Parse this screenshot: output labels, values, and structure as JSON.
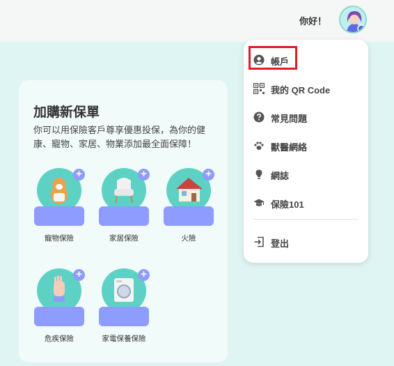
{
  "header": {
    "greeting": "你好！"
  },
  "card": {
    "title": "加購新保單",
    "description": "你可以用保險客戶尊享優惠投保，為你的健康、寵物、家居、物業添加最全面保障！",
    "products": [
      {
        "label": "寵物保險",
        "icon": "pet-dog-icon"
      },
      {
        "label": "家居保險",
        "icon": "armchair-icon"
      },
      {
        "label": "火險",
        "icon": "house-icon"
      },
      {
        "label": "危疾保險",
        "icon": "hand-icon"
      },
      {
        "label": "家電保養保險",
        "icon": "washing-machine-icon"
      }
    ]
  },
  "menu": {
    "items": [
      {
        "label": "帳戶",
        "icon": "account-circle-icon"
      },
      {
        "label": "我的 QR Code",
        "icon": "qr-code-icon"
      },
      {
        "label": "常見問題",
        "icon": "question-icon"
      },
      {
        "label": "獸醫網絡",
        "icon": "paw-icon"
      },
      {
        "label": "網誌",
        "icon": "lightbulb-icon"
      },
      {
        "label": "保險101",
        "icon": "graduation-cap-icon"
      }
    ],
    "logout_label": "登出"
  },
  "colors": {
    "accent": "#8e9cff",
    "teal": "#5dd2c4",
    "highlight": "#e01b24",
    "background": "#dff5f3"
  }
}
